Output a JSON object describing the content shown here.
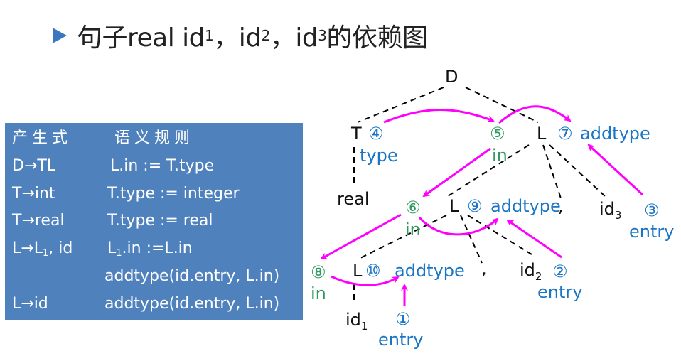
{
  "title": {
    "bullet_icon": "triangle-right",
    "prefix": "句子real  id",
    "sub1": "1",
    "sep1": "，id",
    "sub2": "2",
    "sep2": "，id",
    "sub3": "3",
    "suffix": "的依赖图"
  },
  "rules_table": {
    "header_production": "产生式",
    "header_semantic": "语义规则",
    "rows": [
      {
        "production": "D→TL",
        "semantic": "L.in := T.type"
      },
      {
        "production": "T→int",
        "semantic": "T.type := integer"
      },
      {
        "production": "T→real",
        "semantic": "T.type := real"
      },
      {
        "production_main": "L→L",
        "production_sub": "1",
        "production_tail": ", id",
        "semantic_main": "L",
        "semantic_sub": "1",
        "semantic_tail": ".in :=L.in"
      },
      {
        "production": "",
        "semantic": "addtype(id.entry, L.in)"
      },
      {
        "production": "L→id",
        "semantic": "addtype(id.entry, L.in)"
      }
    ]
  },
  "tree": {
    "nodes": {
      "D": "D",
      "T": "T",
      "L_top": "L",
      "real": "real",
      "L_mid": "L",
      "comma_mid": ",",
      "id3_main": "id",
      "id3_sub": "3",
      "L_low": "L",
      "comma_low": ",",
      "id2_main": "id",
      "id2_sub": "2",
      "id1_main": "id",
      "id1_sub": "1"
    },
    "attributes": {
      "n4": "④",
      "n4_label": "type",
      "n5": "⑤",
      "n5_label": "in",
      "n7": "⑦",
      "n7_label": "addtype",
      "n6": "⑥",
      "n6_label": "in",
      "n9": "⑨",
      "n9_label": "addtype",
      "n3": "③",
      "n3_label": "entry",
      "n8": "⑧",
      "n8_label": "in",
      "n10": "⑩",
      "n10_label": "addtype",
      "n2": "②",
      "n2_label": "entry",
      "n1": "①",
      "n1_label": "entry"
    },
    "colors": {
      "synthesized": "#1a75c4",
      "inherited": "#2f9a5e",
      "edge": "#ff00ff",
      "tree_line": "#000000"
    },
    "dependency_edges": [
      [
        "④ type",
        "⑤ in"
      ],
      [
        "⑤ in",
        "⑦ addtype"
      ],
      [
        "⑤ in",
        "⑥ in"
      ],
      [
        "③ entry",
        "⑦ addtype"
      ],
      [
        "⑥ in",
        "⑧ in"
      ],
      [
        "⑥ in",
        "⑨ addtype"
      ],
      [
        "② entry",
        "⑨ addtype"
      ],
      [
        "⑧ in",
        "⑩ addtype"
      ],
      [
        "① entry",
        "⑩ addtype"
      ]
    ]
  }
}
